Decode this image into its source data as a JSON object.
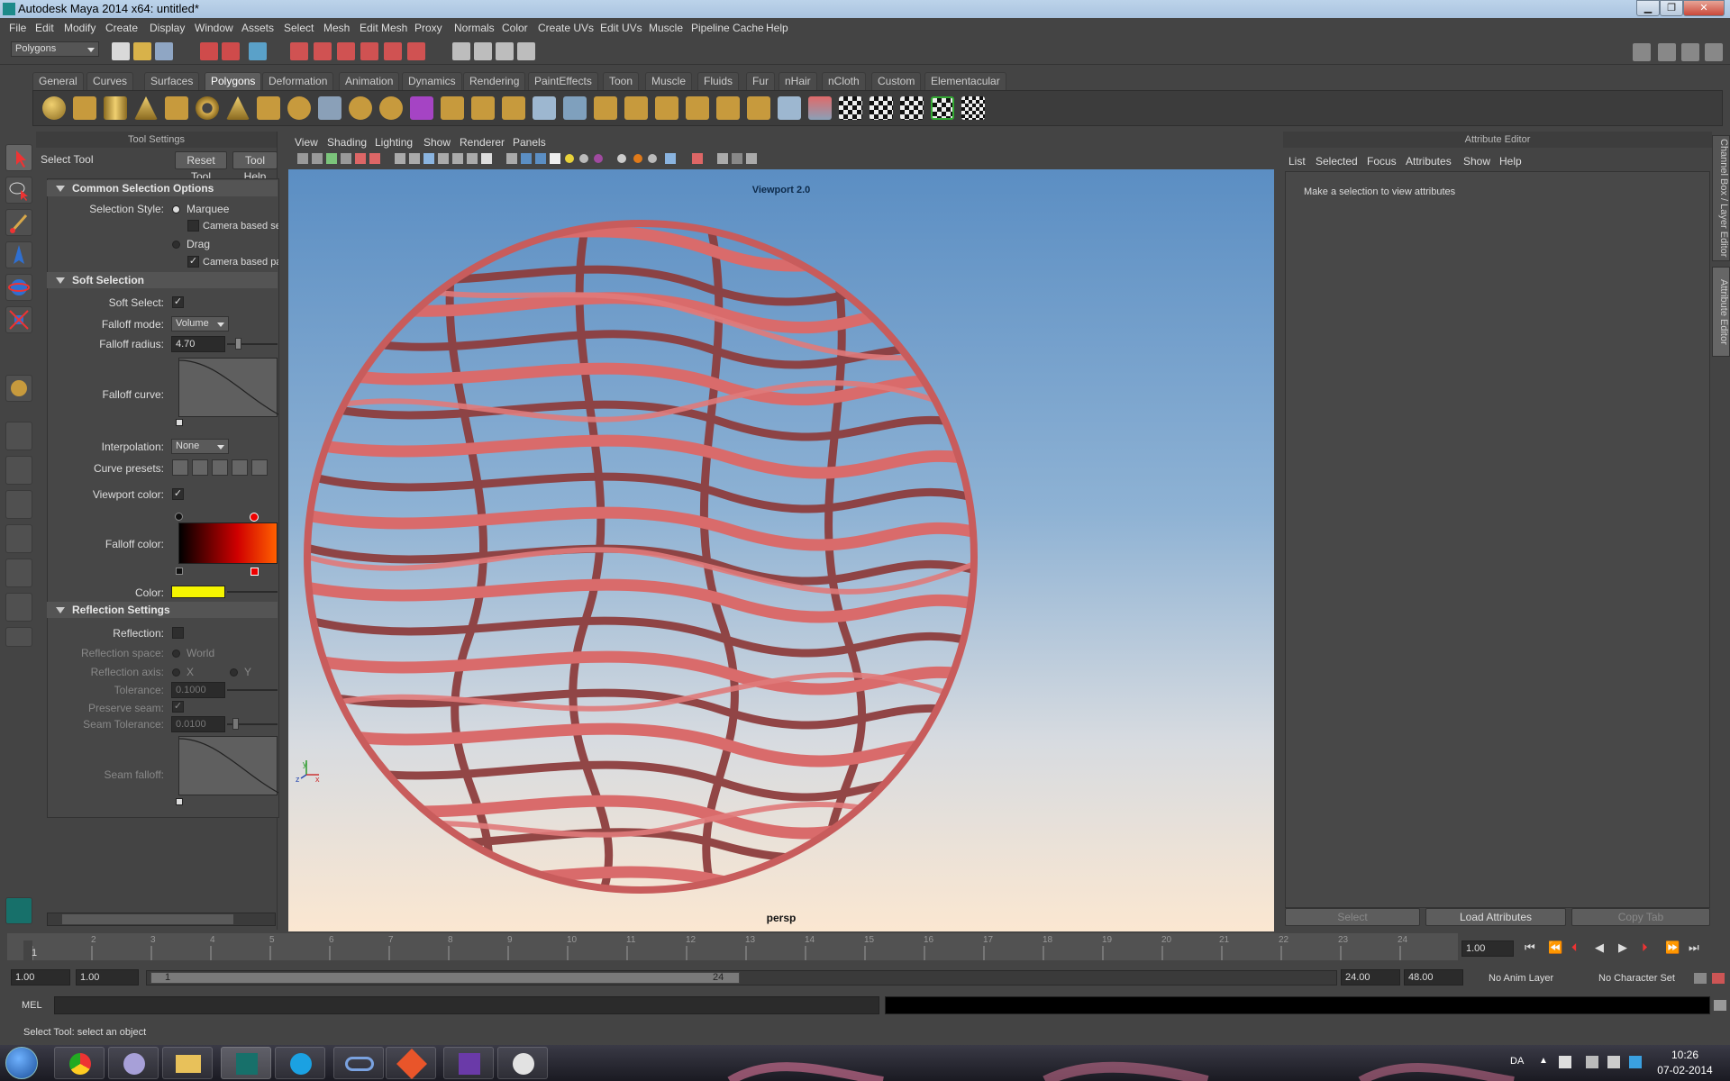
{
  "window": {
    "title": "Autodesk Maya 2014 x64: untitled*"
  },
  "menubar": [
    "File",
    "Edit",
    "Modify",
    "Create",
    "Display",
    "Window",
    "Assets",
    "Select",
    "Mesh",
    "Edit Mesh",
    "Proxy",
    "Normals",
    "Color",
    "Create UVs",
    "Edit UVs",
    "Muscle",
    "Pipeline Cache",
    "Help"
  ],
  "statusline": {
    "menu_set": "Polygons"
  },
  "shelf": {
    "tabs": [
      "General",
      "Curves",
      "Surfaces",
      "Polygons",
      "Deformation",
      "Animation",
      "Dynamics",
      "Rendering",
      "PaintEffects",
      "Toon",
      "Muscle",
      "Fluids",
      "Fur",
      "nHair",
      "nCloth",
      "Custom",
      "Elementacular"
    ],
    "active_tab": "Polygons"
  },
  "tool_settings": {
    "panel_title": "Tool Settings",
    "tool_name": "Select Tool",
    "reset_button": "Reset Tool",
    "help_button": "Tool Help",
    "common": {
      "header": "Common Selection Options",
      "selection_style_label": "Selection Style:",
      "marquee": "Marquee",
      "camera_based_selection": "Camera based se",
      "drag": "Drag",
      "camera_based_paint": "Camera based pa"
    },
    "soft": {
      "header": "Soft Selection",
      "soft_select_label": "Soft Select:",
      "falloff_mode_label": "Falloff mode:",
      "falloff_mode_value": "Volume",
      "falloff_radius_label": "Falloff radius:",
      "falloff_radius_value": "4.70",
      "falloff_curve_label": "Falloff curve:",
      "interpolation_label": "Interpolation:",
      "interpolation_value": "None",
      "curve_presets_label": "Curve presets:",
      "viewport_color_label": "Viewport color:",
      "falloff_color_label": "Falloff color:",
      "color_label": "Color:",
      "color_value": "#f5f500"
    },
    "reflection": {
      "header": "Reflection Settings",
      "reflection_label": "Reflection:",
      "space_label": "Reflection space:",
      "space_value": "World",
      "axis_label": "Reflection axis:",
      "axis_x": "X",
      "axis_y": "Y",
      "tolerance_label": "Tolerance:",
      "tolerance_value": "0.1000",
      "preserve_seam_label": "Preserve seam:",
      "seam_tolerance_label": "Seam Tolerance:",
      "seam_tolerance_value": "0.0100",
      "seam_falloff_label": "Seam falloff:"
    }
  },
  "viewport": {
    "menus": [
      "View",
      "Shading",
      "Lighting",
      "Show",
      "Renderer",
      "Panels"
    ],
    "renderer_label": "Viewport 2.0",
    "camera_label": "persp",
    "axis_y": "y",
    "axis_z": "z",
    "axis_x": "x",
    "object_color": "#d96b6b"
  },
  "attribute_editor": {
    "title": "Attribute Editor",
    "menus": [
      "List",
      "Selected",
      "Focus",
      "Attributes",
      "Show",
      "Help"
    ],
    "message": "Make a selection to view attributes",
    "buttons": [
      "Select",
      "Load Attributes",
      "Copy Tab"
    ],
    "side_tabs": [
      "Channel Box / Layer Editor",
      "Attribute Editor"
    ]
  },
  "time_slider": {
    "ticks": [
      "1",
      "2",
      "3",
      "4",
      "5",
      "6",
      "7",
      "8",
      "9",
      "10",
      "11",
      "12",
      "13",
      "14",
      "15",
      "16",
      "17",
      "18",
      "19",
      "20",
      "21",
      "22",
      "23",
      "24"
    ],
    "current_frame": "1.00"
  },
  "range_slider": {
    "start": "1.00",
    "playback_start": "1.00",
    "range_start": "1",
    "range_end": "24",
    "playback_end": "24.00",
    "end": "48.00",
    "anim_layer": "No Anim Layer",
    "character_set": "No Character Set"
  },
  "command_line": {
    "label": "MEL"
  },
  "help_line": {
    "text": "Select Tool: select an object"
  },
  "taskbar": {
    "language": "DA",
    "time": "10:26",
    "date": "07-02-2014"
  }
}
